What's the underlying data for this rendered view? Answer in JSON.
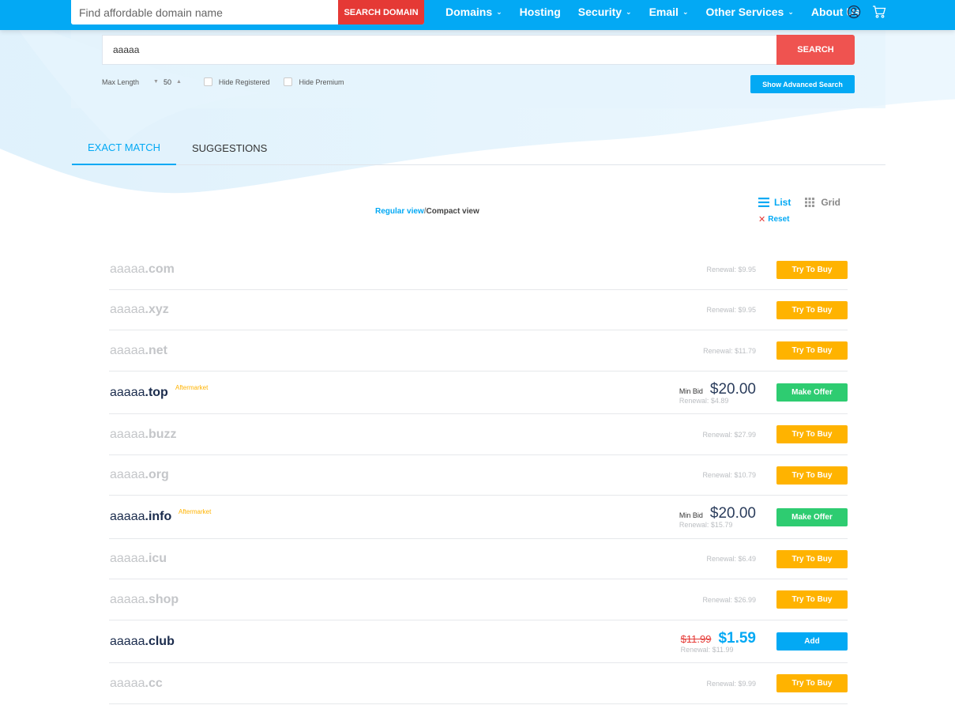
{
  "header": {
    "search_placeholder": "Find affordable domain name",
    "search_button": "SEARCH DOMAIN",
    "nav": [
      {
        "label": "Domains",
        "dropdown": true
      },
      {
        "label": "Hosting",
        "dropdown": false
      },
      {
        "label": "Security",
        "dropdown": true
      },
      {
        "label": "Email",
        "dropdown": true
      },
      {
        "label": "Other Services",
        "dropdown": true
      },
      {
        "label": "About Us",
        "dropdown": false
      }
    ],
    "icons": [
      "user-icon",
      "cart-icon"
    ]
  },
  "search": {
    "value": "aaaaa",
    "button": "SEARCH",
    "max_length_label": "Max Length",
    "max_length_value": "50",
    "hide_registered": "Hide Registered",
    "hide_premium": "Hide Premium",
    "advanced_button": "Show Advanced Search"
  },
  "tabs": [
    {
      "label": "EXACT MATCH",
      "active": true
    },
    {
      "label": "SUGGESTIONS",
      "active": false
    }
  ],
  "view": {
    "regular": "Regular view",
    "separator": "/",
    "compact": "Compact view",
    "list": "List",
    "grid": "Grid",
    "reset": "Reset"
  },
  "results": [
    {
      "name": "aaaaa",
      "tld": ".com",
      "status": "taken",
      "renewal": "Renewal: $9.95",
      "action": "Try To Buy"
    },
    {
      "name": "aaaaa",
      "tld": ".xyz",
      "status": "taken",
      "renewal": "Renewal: $9.95",
      "action": "Try To Buy"
    },
    {
      "name": "aaaaa",
      "tld": ".net",
      "status": "taken",
      "renewal": "Renewal: $11.79",
      "action": "Try To Buy"
    },
    {
      "name": "aaaaa",
      "tld": ".top",
      "status": "aftermarket",
      "badge": "Aftermarket",
      "min_bid_label": "Min Bid",
      "price": "$20.00",
      "renewal": "Renewal: $4.89",
      "action": "Make Offer"
    },
    {
      "name": "aaaaa",
      "tld": ".buzz",
      "status": "taken",
      "renewal": "Renewal: $27.99",
      "action": "Try To Buy"
    },
    {
      "name": "aaaaa",
      "tld": ".org",
      "status": "taken",
      "renewal": "Renewal: $10.79",
      "action": "Try To Buy"
    },
    {
      "name": "aaaaa",
      "tld": ".info",
      "status": "aftermarket",
      "badge": "Aftermarket",
      "min_bid_label": "Min Bid",
      "price": "$20.00",
      "renewal": "Renewal: $15.79",
      "action": "Make Offer"
    },
    {
      "name": "aaaaa",
      "tld": ".icu",
      "status": "taken",
      "renewal": "Renewal: $6.49",
      "action": "Try To Buy"
    },
    {
      "name": "aaaaa",
      "tld": ".shop",
      "status": "taken",
      "renewal": "Renewal: $26.99",
      "action": "Try To Buy"
    },
    {
      "name": "aaaaa",
      "tld": ".club",
      "status": "available",
      "old_price": "$11.99",
      "price": "$1.59",
      "renewal": "Renewal: $11.99",
      "action": "Add"
    },
    {
      "name": "aaaaa",
      "tld": ".cc",
      "status": "taken",
      "renewal": "Renewal: $9.99",
      "action": "Try To Buy"
    }
  ],
  "colors": {
    "brand": "#03a9f4",
    "search_red": "#e53935",
    "buy": "#ffb300",
    "offer": "#2ecc71"
  }
}
